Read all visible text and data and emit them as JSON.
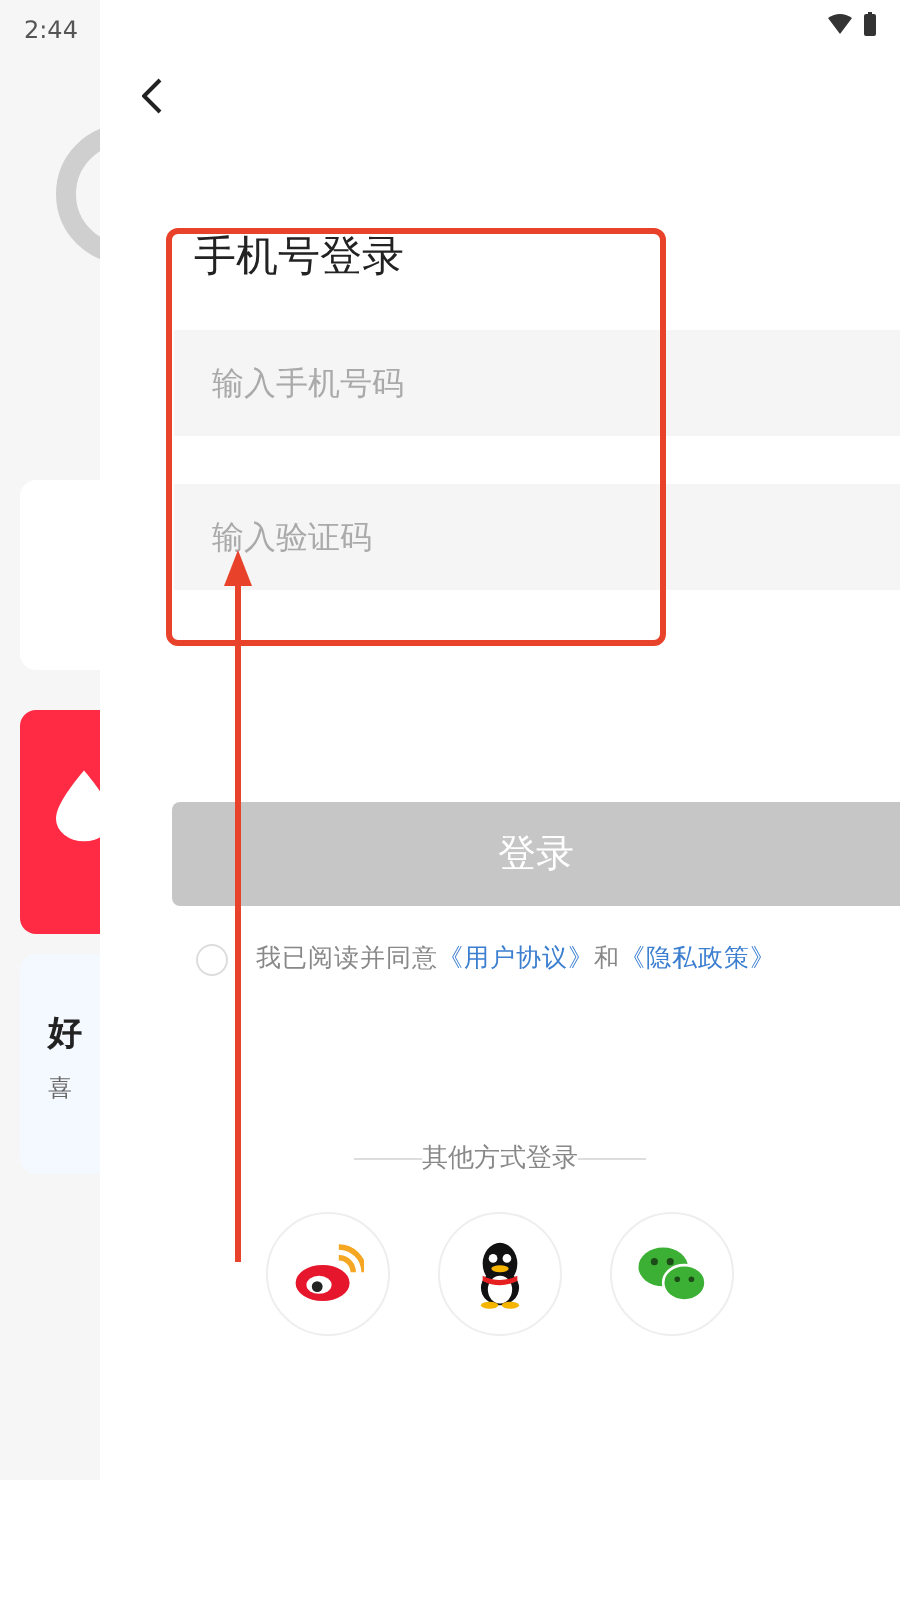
{
  "status_bar": {
    "time": "2:44"
  },
  "background": {
    "cards": [
      {
        "kind": "plain"
      },
      {
        "kind": "red"
      },
      {
        "kind": "text",
        "title": "好",
        "subtitle": "喜"
      }
    ]
  },
  "login": {
    "title": "手机号登录",
    "fields": [
      {
        "placeholder": "输入手机号码"
      },
      {
        "placeholder": "输入验证码"
      }
    ],
    "submit": {
      "label": "登录",
      "disabled": true
    },
    "agreement": {
      "checked": false,
      "text": "我已阅读并同意",
      "conjunction": "和",
      "links": [
        "《用户协议》",
        "《隐私政策》"
      ]
    },
    "other_login": {
      "label": "其他方式登录",
      "providers": [
        {
          "kind": "weibo"
        },
        {
          "kind": "qq"
        },
        {
          "kind": "wechat"
        }
      ]
    }
  }
}
